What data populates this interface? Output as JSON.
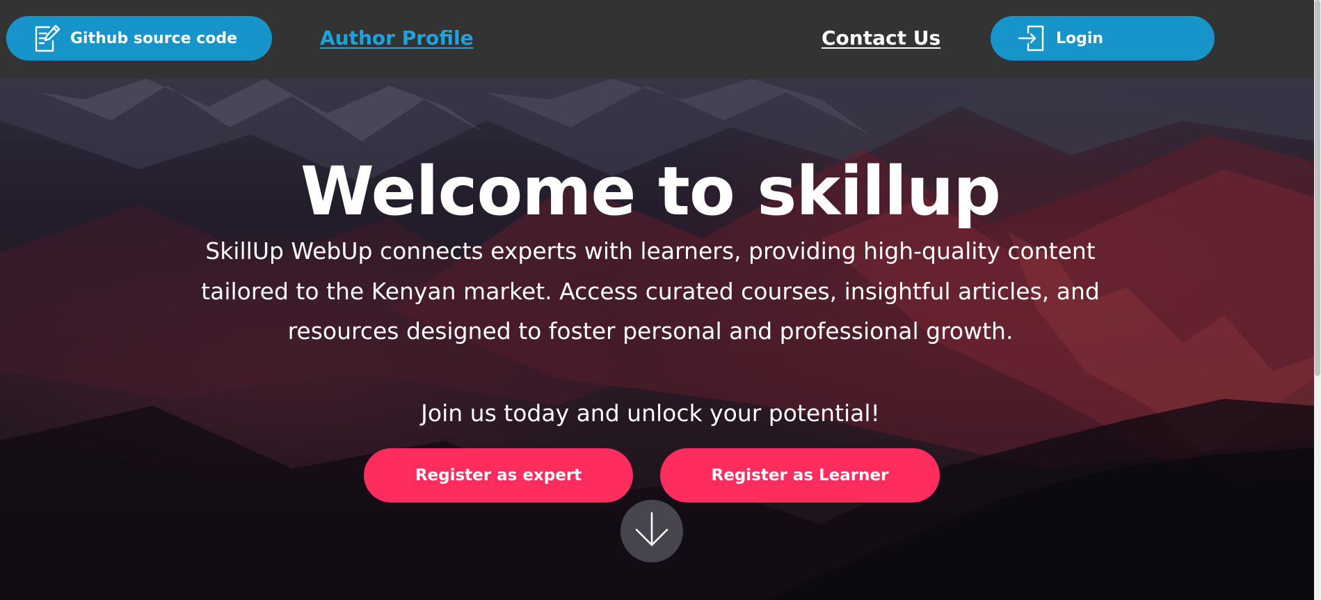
{
  "nav": {
    "github_label": "Github source code",
    "author_label": "Author Profile",
    "contact_label": "Contact Us",
    "login_label": "Login"
  },
  "hero": {
    "title": "Welcome to skillup",
    "description": "SkillUp WebUp connects experts with learners, providing high-quality content tailored to the Kenyan market. Access curated courses, insightful articles, and resources designed to foster personal and professional growth.",
    "cta": "Join us today and unlock your potential!",
    "register_expert_label": "Register as expert",
    "register_learner_label": "Register as Learner"
  },
  "icons": {
    "github": "edit-document-icon",
    "login": "login-arrow-icon",
    "scroll": "arrow-down-icon"
  },
  "colors": {
    "topbar": "#333333",
    "nav_button": "#1794c9",
    "author_link": "#1fa2dd",
    "register_button": "#ff2d5e"
  }
}
